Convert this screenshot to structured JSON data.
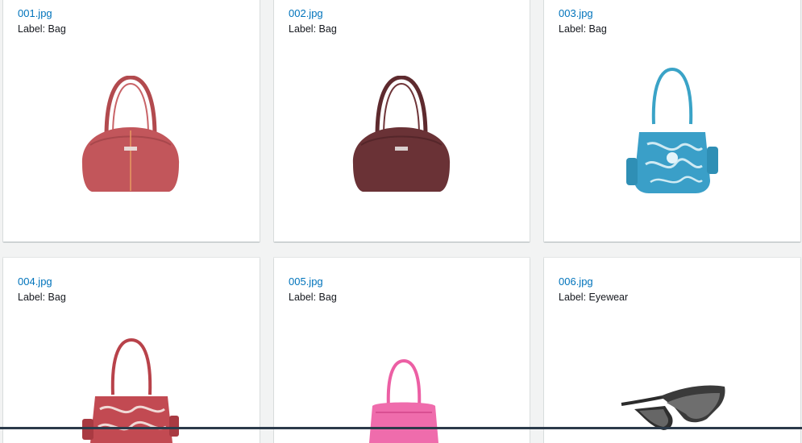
{
  "gallery": {
    "items": [
      {
        "filename": "001.jpg",
        "label_text": "Label: Bag",
        "image": "maroon-bag"
      },
      {
        "filename": "002.jpg",
        "label_text": "Label: Bag",
        "image": "brown-bag"
      },
      {
        "filename": "003.jpg",
        "label_text": "Label: Bag",
        "image": "blue-bag"
      },
      {
        "filename": "004.jpg",
        "label_text": "Label: Bag",
        "image": "red-patterned-bag"
      },
      {
        "filename": "005.jpg",
        "label_text": "Label: Bag",
        "image": "pink-bag"
      },
      {
        "filename": "006.jpg",
        "label_text": "Label: Eyewear",
        "image": "sunglasses"
      }
    ]
  },
  "colors": {
    "link": "#0073bb",
    "text": "#16191f",
    "page_bg": "#f2f3f3",
    "card_bg": "#ffffff"
  }
}
